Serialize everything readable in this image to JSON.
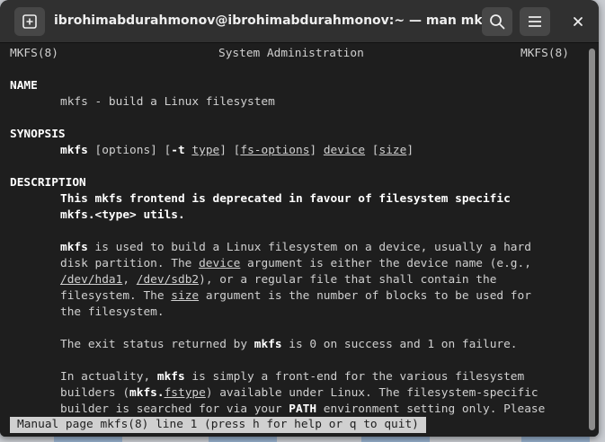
{
  "window": {
    "title": "ibrohimabdurahmonov@ibrohimabdurahmonov:~ — man mkfs",
    "new_tab_icon": "new-tab-icon",
    "search_icon": "search-icon",
    "menu_icon": "hamburger-menu-icon",
    "close_icon": "close-icon"
  },
  "man": {
    "header_left": "MKFS(8)",
    "header_center": "System Administration",
    "header_right": "MKFS(8)",
    "name_heading": "NAME",
    "name_text": "mkfs - build a Linux filesystem",
    "synopsis_heading": "SYNOPSIS",
    "syn_cmd": "mkfs",
    "syn_p1": " [options] [",
    "syn_t": "-t",
    "syn_sp": " ",
    "syn_type": "type",
    "syn_p2": "] [",
    "syn_fsopt": "fs-options",
    "syn_p3": "] ",
    "syn_device": "device",
    "syn_p4": " [",
    "syn_size": "size",
    "syn_p5": "]",
    "description_heading": "DESCRIPTION",
    "d1": "This mkfs frontend is deprecated in favour of filesystem specific",
    "d2": "mkfs.<type> utils.",
    "p1_cmd": "mkfs",
    "p1_l1": " is used to build a Linux filesystem on a device, usually a hard",
    "p1_l2a": "disk partition. The ",
    "p1_l2dev": "device",
    "p1_l2b": " argument is either the device name (e.g.,",
    "p1_l3hda": "/dev/hda1",
    "p1_l3a": ", ",
    "p1_l3sdb": "/dev/sdb2",
    "p1_l3b": "), or a regular file that shall contain the",
    "p1_l4a": "filesystem. The ",
    "p1_l4size": "size",
    "p1_l4b": " argument is the number of blocks to be used for",
    "p1_l5": "the filesystem.",
    "p2_a": "The exit status returned by ",
    "p2_cmd": "mkfs",
    "p2_b": " is 0 on success and 1 on failure.",
    "p3_l1a": "In actuality, ",
    "p3_l1cmd": "mkfs",
    "p3_l1b": " is simply a front-end for the various filesystem",
    "p3_l2a": "builders (",
    "p3_l2cmd": "mkfs.",
    "p3_l2fs": "fstype",
    "p3_l2b": ") available under Linux. The filesystem-specific",
    "p3_l3a": "builder is searched for via your ",
    "p3_l3path": "PATH",
    "p3_l3b": " environment setting only. Please",
    "status": "Manual page mkfs(8) line 1 (press h for help or q to quit)"
  }
}
